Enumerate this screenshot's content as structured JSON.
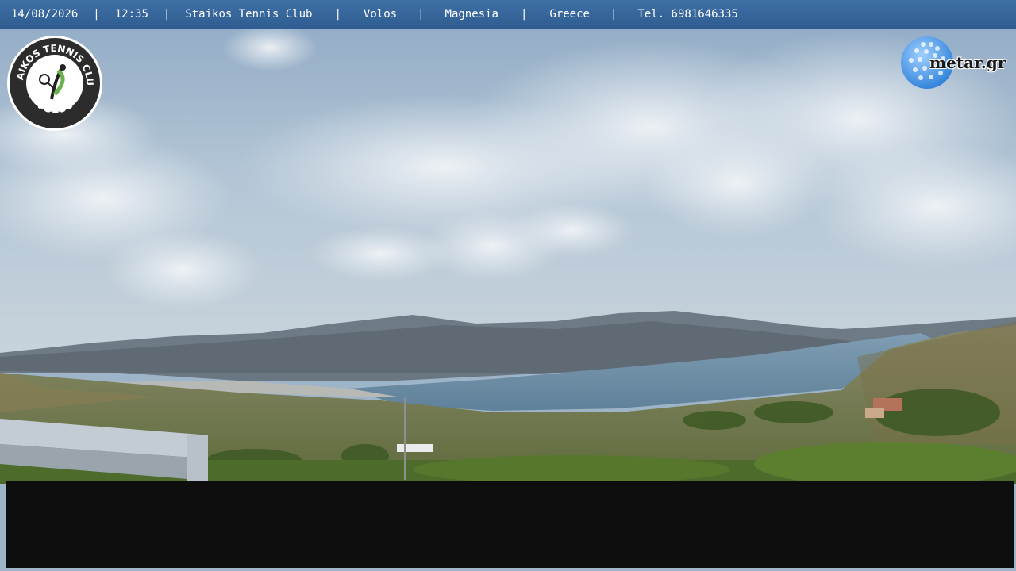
{
  "header": {
    "date": "14/08/2026",
    "time": "12:35",
    "club": "Staikos Tennis Club",
    "city": "Volos",
    "region": "Magnesia",
    "country": "Greece",
    "phone": "Tel. 6981646335",
    "separator": "|"
  },
  "logos": {
    "club_logo_text_top": "STAIKOS TENNIS CLUB",
    "club_logo_text_bottom": "VOLOS",
    "metar": "metar.gr"
  },
  "colors": {
    "topbar": "#3466a0",
    "sky": "#a9bfd4",
    "sea": "#6f8fa6",
    "overlay": "#0e0e0e"
  }
}
